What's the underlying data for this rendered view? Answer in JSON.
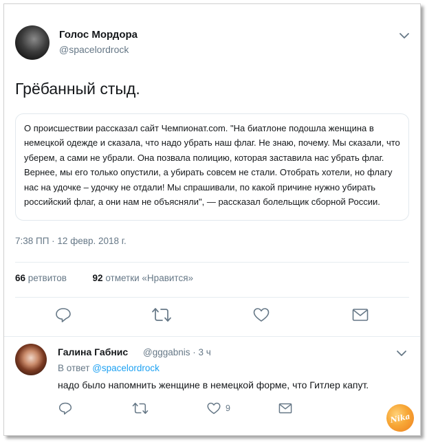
{
  "tweet": {
    "author_name": "Голос Мордора",
    "author_handle": "@spacelordrock",
    "text": "Грёбанный стыд.",
    "quote": "О происшествии рассказал сайт Чемпионат.com. \"На биатлоне подошла женщина в немецкой одежде и сказала, что надо убрать наш флаг. Не знаю, почему. Мы сказали, что уберем, а сами не убрали. Она позвала полицию, которая заставила нас убрать флаг. Вернее, мы его только опустили, а убирать совсем не стали. Отобрать хотели, но флагу нас на удочке – удочку не отдали! Мы спрашивали, по какой причине нужно убирать российский флаг, а они нам не объясняли\", — рассказал болельщик сборной России.",
    "timestamp": "7:38 ПП · 12 февр. 2018 г.",
    "retweets_count": "66",
    "retweets_label": "ретвитов",
    "likes_count": "92",
    "likes_label": "отметки «Нравится»"
  },
  "reply": {
    "author_name": "Галина Габнис",
    "author_handle": "@gggabnis",
    "time": "· 3 ч",
    "reply_to_prefix": "В ответ",
    "reply_to_handle": "@spacelordrock",
    "text": "надо было напомнить женщине в немецкой форме, что Гитлер капут.",
    "likes_count": "9"
  },
  "watermark": {
    "text": "Nika"
  },
  "icons": {
    "menu": "chevron-down-icon",
    "reply": "reply-icon",
    "retweet": "retweet-icon",
    "like": "heart-icon",
    "dm": "mail-icon"
  },
  "colors": {
    "accent": "#1da1f2",
    "icon": "#657786",
    "text": "#14171a",
    "border": "#e1e8ed",
    "watermark": "#f29a2e"
  }
}
